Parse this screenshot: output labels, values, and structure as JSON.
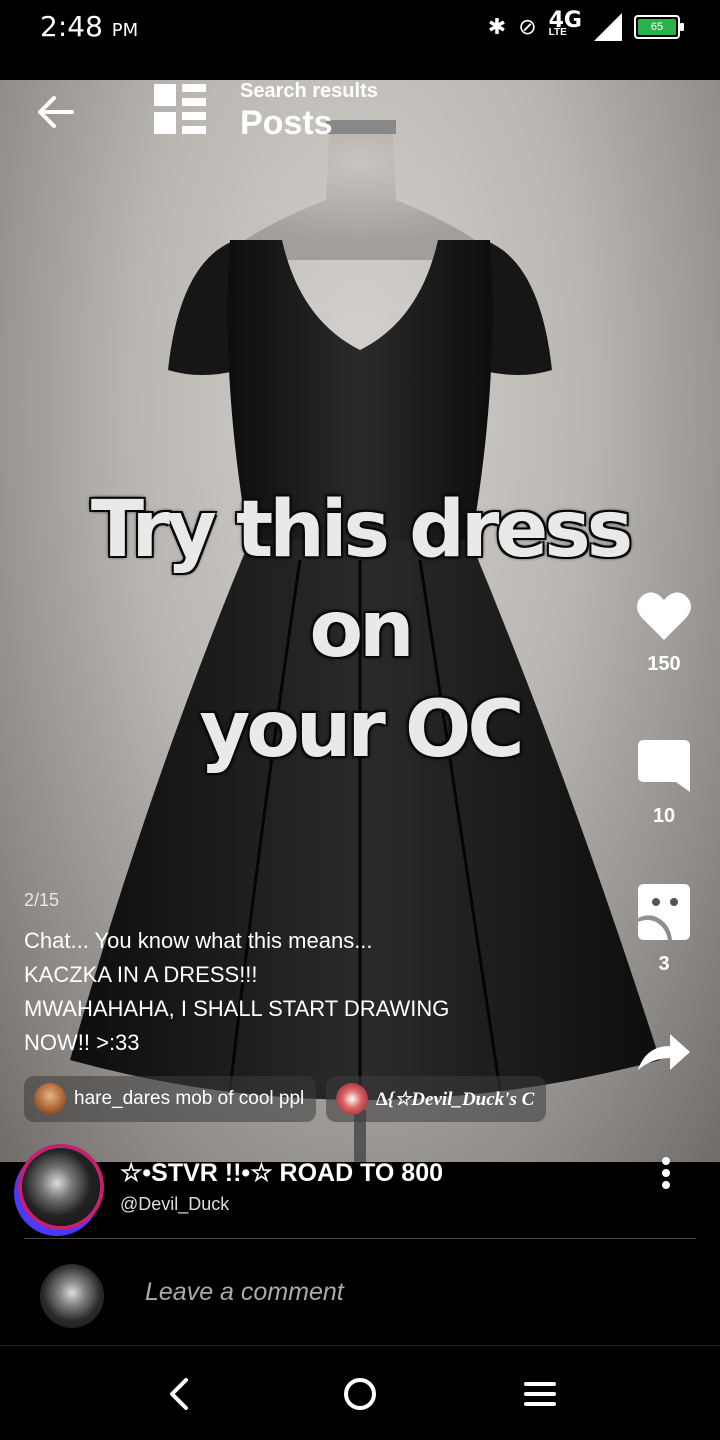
{
  "status_bar": {
    "time": "2:48",
    "meridiem": "PM",
    "network": "4G",
    "network_sub": "LTE",
    "battery": "65",
    "icons": [
      "bluetooth-icon",
      "do-not-disturb-icon",
      "signal-icon",
      "battery-icon"
    ]
  },
  "header": {
    "subtitle": "Search results",
    "title": "Posts"
  },
  "post": {
    "overlay_line1": "Try this dress on",
    "overlay_line2": "your OC",
    "page_indicator": "2/15",
    "caption_lines": [
      "Chat... You know what this means...",
      "KACZKA IN A DRESS!!!",
      "MWAHAHAHA, I SHALL START DRAWING",
      "NOW!! >:33"
    ],
    "chips": [
      {
        "label": "hare_dares mob of cool ppl"
      },
      {
        "label": "∆{☆Devil_Duck's C"
      }
    ]
  },
  "actions": {
    "likes": "150",
    "comments": "10",
    "reactions": "3"
  },
  "author": {
    "name": "☆•STVR !!•☆  ROAD TO 800",
    "handle": "@Devil_Duck"
  },
  "comment": {
    "placeholder": "Leave a comment"
  },
  "colors": {
    "background": "#000000",
    "battery": "#2ab34a",
    "avatar_ring": "#c6206f"
  }
}
